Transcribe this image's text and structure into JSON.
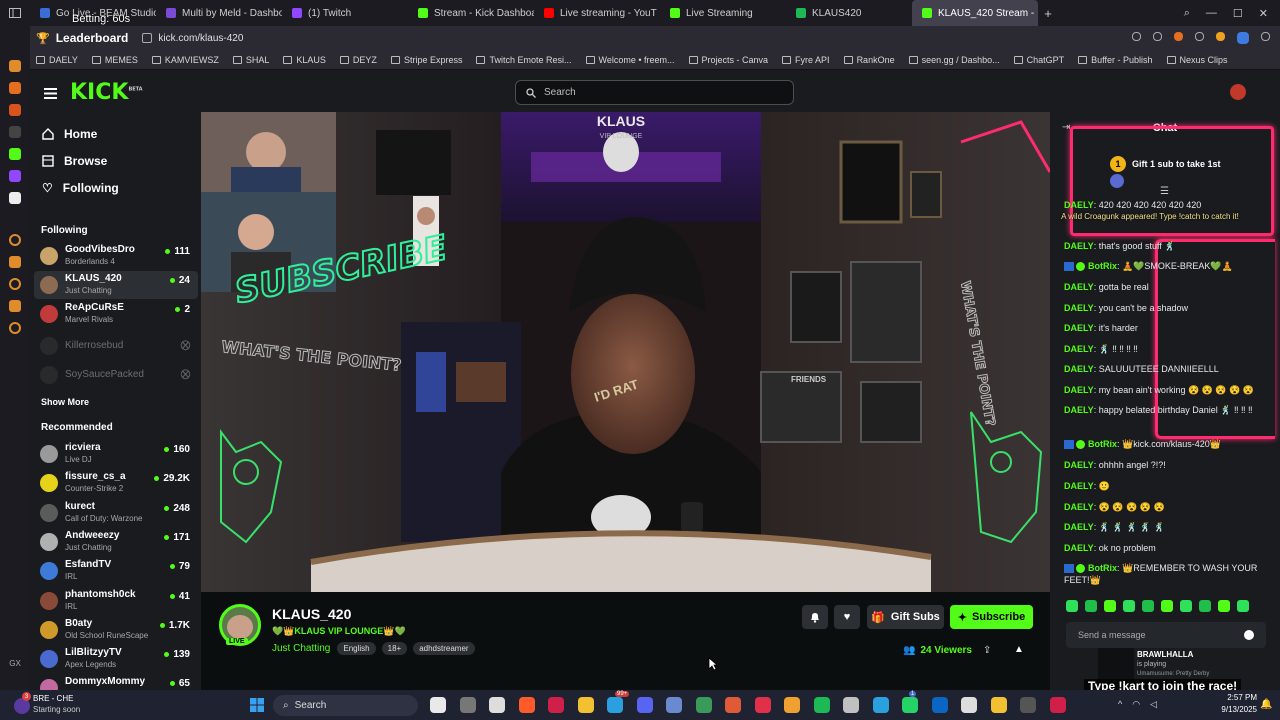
{
  "browser": {
    "tabs": [
      {
        "title": "Go Live - BEAM Studio",
        "color": "#3a6dd8"
      },
      {
        "title": "Multi by Meld - Dashboar",
        "color": "#7a4bd6"
      },
      {
        "title": "(1) Twitch",
        "color": "#9146ff"
      },
      {
        "title": "Stream - Kick Dashboard",
        "color": "#53fc18"
      },
      {
        "title": "Live streaming - YouT",
        "color": "#ff0000"
      },
      {
        "title": "Live Streaming",
        "color": "#53fc18"
      },
      {
        "title": "KLAUS420",
        "color": "#1db954"
      },
      {
        "title": "KLAUS_420 Stream -",
        "color": "#53fc18"
      }
    ],
    "url": "kick.com/klaus-420",
    "bookmarks": [
      "DAELY",
      "MEMES",
      "KAMVIEWSZ",
      "SHAL",
      "KLAUS",
      "DEYZ",
      "Stripe Express",
      "Twitch Emote Resi...",
      "Welcome • freem...",
      "Projects - Canva",
      "Fyre API",
      "RankOne",
      "seen.gg / Dashbo...",
      "ChatGPT",
      "Buffer - Publish",
      "Nexus Clips"
    ]
  },
  "overlay": {
    "betting": "Betting: 60s",
    "leaderboard": "Leaderboard"
  },
  "header": {
    "logo": "KICK",
    "logo_sup": "BETA",
    "search_placeholder": "Search"
  },
  "sidebar": {
    "nav": [
      {
        "label": "Home",
        "icon": "home-icon"
      },
      {
        "label": "Browse",
        "icon": "browse-icon"
      },
      {
        "label": "Following",
        "icon": "heart-icon"
      }
    ],
    "following_title": "Following",
    "following": [
      {
        "name": "GoodVibesDro",
        "category": "Borderlands 4",
        "viewers": "111",
        "color": "#c9a46a"
      },
      {
        "name": "KLAUS_420",
        "category": "Just Chatting",
        "viewers": "24",
        "color": "#8c6b52"
      },
      {
        "name": "ReApCuRsE",
        "category": "Marvel Rivals",
        "viewers": "2",
        "color": "#c23b3b"
      }
    ],
    "offline": [
      "Killerrosebud",
      "SoySaucePacked"
    ],
    "show_more": "Show More",
    "recommended_title": "Recommended",
    "recommended": [
      {
        "name": "ricviera",
        "category": "Live DJ",
        "viewers": "160",
        "color": "#9a9a9a"
      },
      {
        "name": "fissure_cs_a",
        "category": "Counter-Strike 2",
        "viewers": "29.2K",
        "color": "#e6d21b"
      },
      {
        "name": "kurect",
        "category": "Call of Duty: Warzone",
        "viewers": "248",
        "color": "#5b5b5b"
      },
      {
        "name": "Andweeezy",
        "category": "Just Chatting",
        "viewers": "171",
        "color": "#b0b0b0"
      },
      {
        "name": "EsfandTV",
        "category": "IRL",
        "viewers": "79",
        "color": "#3f7ad9"
      },
      {
        "name": "phantomsh0ck",
        "category": "IRL",
        "viewers": "41",
        "color": "#8a4a3a"
      },
      {
        "name": "B0aty",
        "category": "Old School RuneScape",
        "viewers": "1.7K",
        "color": "#d09a2a"
      },
      {
        "name": "LilBlitzyyTV",
        "category": "Apex Legends",
        "viewers": "139",
        "color": "#4a6ad0"
      },
      {
        "name": "DommyxMommy",
        "category": "",
        "viewers": "65",
        "color": "#c26aa0"
      }
    ]
  },
  "stream": {
    "channel": "KLAUS_420",
    "title": "💚👑KLAUS VIP LOUNGE👑💚",
    "category": "Just Chatting",
    "tags": [
      "English",
      "18+",
      "adhdstreamer"
    ],
    "live_badge": "LIVE",
    "viewers": "24 Viewers",
    "gift_subs": "Gift Subs",
    "subscribe": "Subscribe"
  },
  "video_text": {
    "sign_top": "KLAUS",
    "sign_top_sub": "VIP LOUNGE",
    "subscribe_art": "SUBSCRIBE",
    "shirt_text": "I'D RAT",
    "friends_text": "FRIENDS",
    "whats_point_left": "WHAT'S THE POINT?",
    "whats_point_right": "WHAT'S THE POINT?"
  },
  "chat": {
    "title": "Chat",
    "gift_banner": "Gift 1 sub to take 1st",
    "gift_rank": "1",
    "notice": "A wild Croagunk appeared! Type !catch to catch it!",
    "messages": [
      {
        "user": "DAELY",
        "text": ": 420 420 420 420 420 420"
      },
      {
        "user": "DAELY",
        "text": ": that's good stuff 🕺"
      },
      {
        "user": "BotRix",
        "text": ": 🧘💚SMOKE-BREAK💚🧘",
        "bot": true
      },
      {
        "user": "DAELY",
        "text": ": gotta be real"
      },
      {
        "user": "DAELY",
        "text": ": you can't be a shadow"
      },
      {
        "user": "DAELY",
        "text": ": it's harder"
      },
      {
        "user": "DAELY",
        "text": ": 🕺 ‼ ‼ ‼ ‼"
      },
      {
        "user": "DAELY",
        "text": ": SALUUUTEEE DANNIIEELLL"
      },
      {
        "user": "DAELY",
        "text": ": my bean ain't working 😵 😵 😵 😵 😵"
      },
      {
        "user": "DAELY",
        "text": ": happy belated birthday Daniel 🕺 ‼ ‼ ‼"
      },
      {
        "user": "BotRix",
        "text": ": 👑kick.com/klaus-420👑",
        "bot": true
      },
      {
        "user": "DAELY",
        "text": ": ohhhh angel ?!?!"
      },
      {
        "user": "DAELY",
        "text": ": 🙂"
      },
      {
        "user": "DAELY",
        "text": ": 😵 😵 😵 😵 😵"
      },
      {
        "user": "DAELY",
        "text": ": 🕺 🕺 🕺 🕺 🕺"
      },
      {
        "user": "DAELY",
        "text": ": ok no problem"
      },
      {
        "user": "BotRix",
        "text": ": 👑REMEMBER TO WASH YOUR FEET!👑",
        "bot": true
      }
    ],
    "input_placeholder": "Send a message",
    "brawl_name": "BRAWLHALLA",
    "brawl_status": "is playing",
    "brawl_song": "Umamusume: Pretty Derby",
    "race_text": "Type !kart to join the race!"
  },
  "taskbar": {
    "weather_title": "BRE - CHE",
    "weather_sub": "Starting soon",
    "weather_badge": "3",
    "search": "Search",
    "time": "2:57 PM",
    "date": "9/13/2025",
    "badge_a": "99+",
    "badge_b": "1"
  },
  "colors": {
    "kick_green": "#53fc18",
    "chat_bg": "#191b1f",
    "page_bg": "#0b0e0f",
    "neon_pink": "#ff2b6e"
  }
}
